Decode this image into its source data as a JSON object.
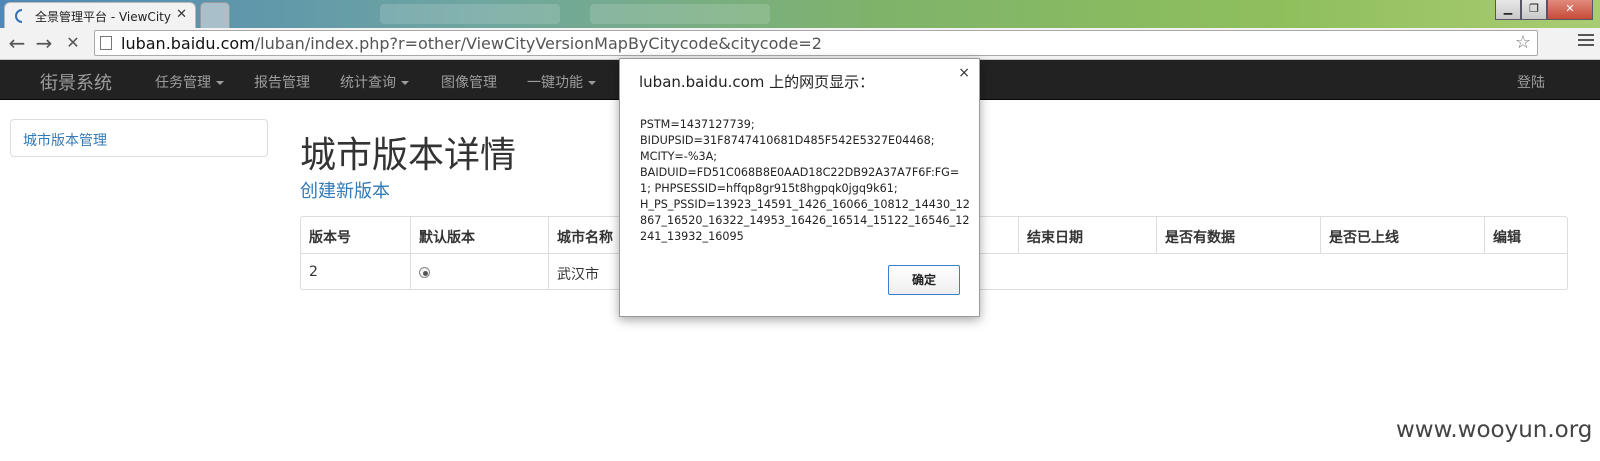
{
  "browser": {
    "active_tab_title": "全景管理平台 - ViewCity",
    "tab_close": "✕",
    "address_domain": "luban.baidu.com",
    "address_path": "/luban/index.php?r=other/ViewCityVersionMapByCitycode&citycode=2",
    "star_icon": "☆"
  },
  "navbar": {
    "brand": "街景系统",
    "items": [
      {
        "label": "任务管理",
        "dropdown": true
      },
      {
        "label": "报告管理",
        "dropdown": false
      },
      {
        "label": "统计查询",
        "dropdown": true
      },
      {
        "label": "图像管理",
        "dropdown": false
      },
      {
        "label": "一键功能",
        "dropdown": true
      }
    ],
    "login": "登陆"
  },
  "sidebar": {
    "link": "城市版本管理"
  },
  "main": {
    "title": "城市版本详情",
    "create_link": "创建新版本",
    "table": {
      "headers": [
        "版本号",
        "默认版本",
        "城市名称",
        "结束日期",
        "是否有数据",
        "是否已上线",
        "编辑"
      ],
      "row": {
        "version": "2",
        "default_selected": true,
        "city": "武汉市"
      }
    }
  },
  "dialog": {
    "title": "luban.baidu.com 上的网页显示：",
    "close": "×",
    "message": "PSTM=1437127739;\nBIDUPSID=31F8747410681D485F542E5327E04468;\nMCITY=-%3A;\nBAIDUID=FD51C068B8E0AAD18C22DB92A37A7F6F:FG=1; PHPSESSID=hffqp8gr915t8hgpqk0jgq9k61;\nH_PS_PSSID=13923_14591_1426_16066_10812_14430_12867_16520_16322_14953_16426_16514_15122_16546_12241_13932_16095",
    "ok": "确定"
  },
  "watermark": "www.wooyun.org"
}
